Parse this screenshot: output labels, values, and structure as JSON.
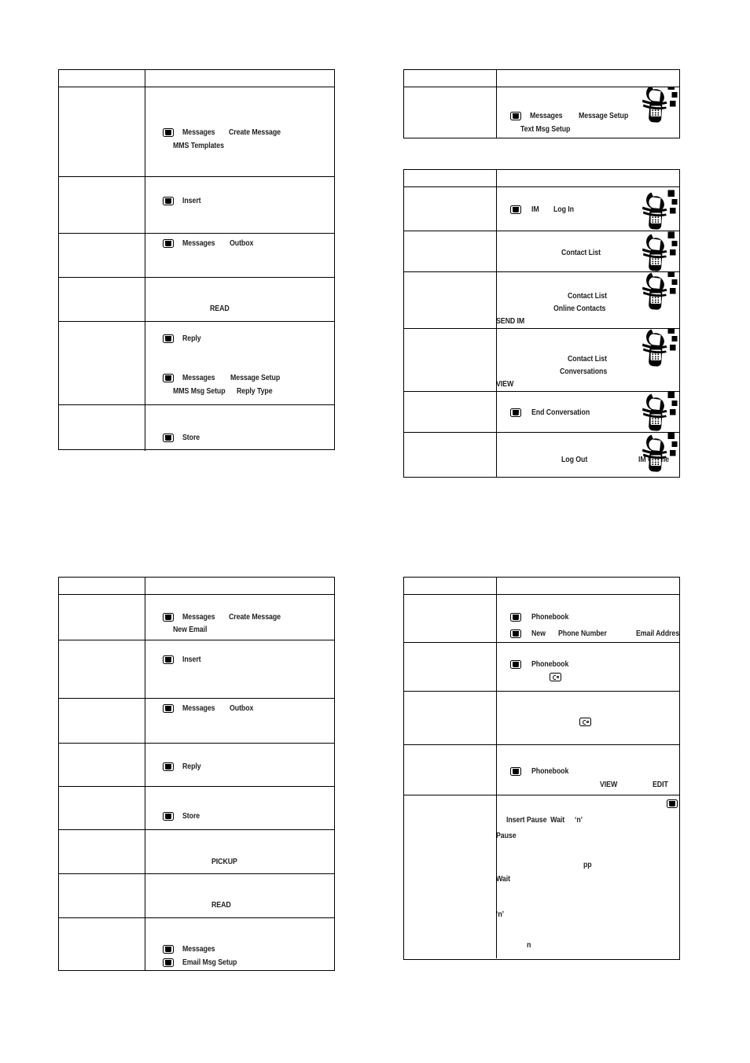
{
  "document": {
    "type": "mobile-phone-user-guide-quick-reference",
    "icons": {
      "menu_key": "menu-key-icon",
      "send_key": "send-key-icon",
      "phone": "phone-illustration-icon"
    },
    "colors": {
      "text": "#231f20",
      "border": "#000000",
      "background": "#ffffff"
    }
  },
  "tables": [
    {
      "id": "mms-messaging",
      "position": "top-left",
      "header": {
        "col1": "",
        "col2": ""
      },
      "rows": [
        {
          "col1": "",
          "lines": [
            {
              "menu_key": true,
              "text": "Messages     Create Message"
            },
            {
              "menu_key": false,
              "text": "MMS Templates"
            }
          ]
        },
        {
          "col1": "",
          "lines": [
            {
              "menu_key": true,
              "text": "Insert"
            }
          ]
        },
        {
          "col1": "",
          "lines": [
            {
              "menu_key": true,
              "text": "Messages     Outbox"
            }
          ]
        },
        {
          "col1": "",
          "lines": [
            {
              "menu_key": false,
              "text": "READ"
            }
          ]
        },
        {
          "col1": "",
          "lines": [
            {
              "menu_key": true,
              "text": "Reply"
            },
            {
              "menu_key": true,
              "text": "Messages     Message Setup"
            },
            {
              "menu_key": false,
              "text": "MMS Msg Setup     Reply Type"
            }
          ]
        },
        {
          "col1": "",
          "lines": [
            {
              "menu_key": true,
              "text": "Store"
            }
          ]
        }
      ]
    },
    {
      "id": "text-msg-setup",
      "position": "top-right-upper",
      "header": {
        "col1": "",
        "col2": ""
      },
      "rows": [
        {
          "col1": "",
          "lines": [
            {
              "menu_key": true,
              "text": "Messages     Message Setup"
            },
            {
              "menu_key": false,
              "text": "Text Msg Setup"
            }
          ]
        }
      ]
    },
    {
      "id": "instant-messaging",
      "position": "top-right-lower",
      "header": {
        "col1": "",
        "col2": ""
      },
      "rows": [
        {
          "col1": "",
          "lines": [
            {
              "menu_key": true,
              "text": "IM     Log In"
            }
          ]
        },
        {
          "col1": "",
          "lines": [
            {
              "menu_key": false,
              "text": "Contact List"
            }
          ]
        },
        {
          "col1": "",
          "lines": [
            {
              "menu_key": false,
              "text": "Contact List"
            },
            {
              "menu_key": false,
              "text": "Online Contacts"
            },
            {
              "menu_key": false,
              "text": "SEND IM"
            }
          ]
        },
        {
          "col1": "",
          "lines": [
            {
              "menu_key": false,
              "text": "Contact List"
            },
            {
              "menu_key": false,
              "text": "Conversations"
            },
            {
              "menu_key": false,
              "text": "VIEW"
            }
          ]
        },
        {
          "col1": "",
          "lines": [
            {
              "menu_key": true,
              "text": "End Conversation"
            }
          ]
        },
        {
          "col1": "",
          "lines": [
            {
              "menu_key": false,
              "text": "Log Out            IM Online"
            }
          ]
        }
      ]
    },
    {
      "id": "email-messaging",
      "position": "bottom-left",
      "header": {
        "col1": "",
        "col2": ""
      },
      "rows": [
        {
          "col1": "",
          "lines": [
            {
              "menu_key": true,
              "text": "Messages     Create Message"
            },
            {
              "menu_key": false,
              "text": "New Email"
            }
          ]
        },
        {
          "col1": "",
          "lines": [
            {
              "menu_key": true,
              "text": "Insert"
            }
          ]
        },
        {
          "col1": "",
          "lines": [
            {
              "menu_key": true,
              "text": "Messages     Outbox"
            }
          ]
        },
        {
          "col1": "",
          "lines": [
            {
              "menu_key": true,
              "text": "Reply"
            }
          ]
        },
        {
          "col1": "",
          "lines": [
            {
              "menu_key": true,
              "text": "Store"
            }
          ]
        },
        {
          "col1": "",
          "lines": [
            {
              "menu_key": false,
              "text": "PICKUP"
            }
          ]
        },
        {
          "col1": "",
          "lines": [
            {
              "menu_key": false,
              "text": "READ"
            }
          ]
        },
        {
          "col1": "",
          "lines": [
            {
              "menu_key": true,
              "text": "Messages"
            },
            {
              "menu_key": true,
              "text": "Email Msg Setup"
            }
          ]
        }
      ]
    },
    {
      "id": "phonebook",
      "position": "bottom-right",
      "header": {
        "col1": "",
        "col2": ""
      },
      "rows": [
        {
          "col1": "",
          "lines": [
            {
              "menu_key": true,
              "text": "Phonebook"
            },
            {
              "menu_key": true,
              "text": "New     Phone Number     Email Address"
            }
          ]
        },
        {
          "col1": "",
          "lines": [
            {
              "menu_key": true,
              "text": "Phonebook"
            },
            {
              "send_key": true,
              "text": ""
            }
          ]
        },
        {
          "col1": "",
          "lines": [
            {
              "send_key": true,
              "text": ""
            }
          ]
        },
        {
          "col1": "",
          "lines": [
            {
              "menu_key": true,
              "text": "Phonebook"
            },
            {
              "menu_key": false,
              "text": "VIEW                EDIT"
            }
          ]
        },
        {
          "col1": "",
          "lines": [
            {
              "menu_key": false,
              "text": "Insert Pause  Wait       ‘n’"
            },
            {
              "menu_key": false,
              "text": "Pause"
            },
            {
              "menu_key": false,
              "text": "pp"
            },
            {
              "menu_key": false,
              "text": "Wait"
            },
            {
              "menu_key": false,
              "text": "‘n’"
            },
            {
              "menu_key": false,
              "text": "n"
            }
          ]
        }
      ]
    }
  ],
  "labels": {
    "t1": {
      "r1a": "Messages",
      "r1b": "Create Message",
      "r1c": "MMS Templates",
      "r2a": "Insert",
      "r3a": "Messages",
      "r3b": "Outbox",
      "r4a": "READ",
      "r5a": "Reply",
      "r5b": "Messages",
      "r5c": "Message Setup",
      "r5d": "MMS Msg Setup",
      "r5e": "Reply Type",
      "r6a": "Store"
    },
    "t2": {
      "r1a": "Messages",
      "r1b": "Message Setup",
      "r1c": "Text Msg Setup"
    },
    "t3": {
      "r1a": "IM",
      "r1b": "Log In",
      "r2a": "Contact List",
      "r3a": "Contact List",
      "r3b": "Online Contacts",
      "r3c": "SEND IM",
      "r4a": "Contact List",
      "r4b": "Conversations",
      "r4c": "VIEW",
      "r5a": "End Conversation",
      "r6a": "Log Out",
      "r6b": "IM Online"
    },
    "t4": {
      "r1a": "Messages",
      "r1b": "Create Message",
      "r1c": "New Email",
      "r2a": "Insert",
      "r3a": "Messages",
      "r3b": "Outbox",
      "r4a": "Reply",
      "r5a": "Store",
      "r6a": "PICKUP",
      "r7a": "READ",
      "r8a": "Messages",
      "r8b": "Email Msg Setup"
    },
    "t5": {
      "r1a": "Phonebook",
      "r1b": "New",
      "r1c": "Phone Number",
      "r1d": "Email Address",
      "r2a": "Phonebook",
      "r4a": "Phonebook",
      "r4b": "VIEW",
      "r4c": "EDIT",
      "r5a": "Insert Pause  Wait",
      "r5b": "‘n’",
      "r5c": "Pause",
      "r5d": "pp",
      "r5e": "Wait",
      "r5f": "‘n’",
      "r5g": "n"
    }
  }
}
